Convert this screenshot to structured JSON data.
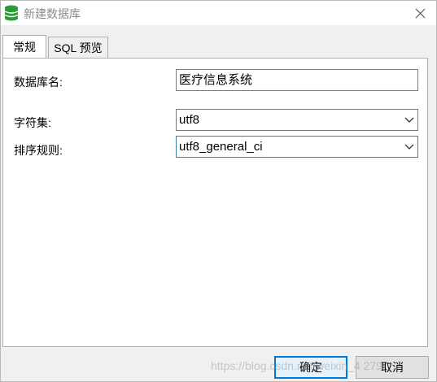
{
  "window": {
    "title": "新建数据库",
    "icon": "database-icon",
    "accent": "#0078d7"
  },
  "tabs": [
    {
      "label": "常规",
      "active": true
    },
    {
      "label": "SQL 预览",
      "active": false
    }
  ],
  "form": {
    "db_name_label": "数据库名:",
    "db_name_value": "医疗信息系统",
    "charset_label": "字符集:",
    "charset_value": "utf8",
    "collation_label": "排序规则:",
    "collation_value": "utf8_general_ci"
  },
  "buttons": {
    "ok_label": "确定",
    "cancel_label": "取消"
  },
  "watermark": "https://blog.csdn.net/weixin_4  279"
}
